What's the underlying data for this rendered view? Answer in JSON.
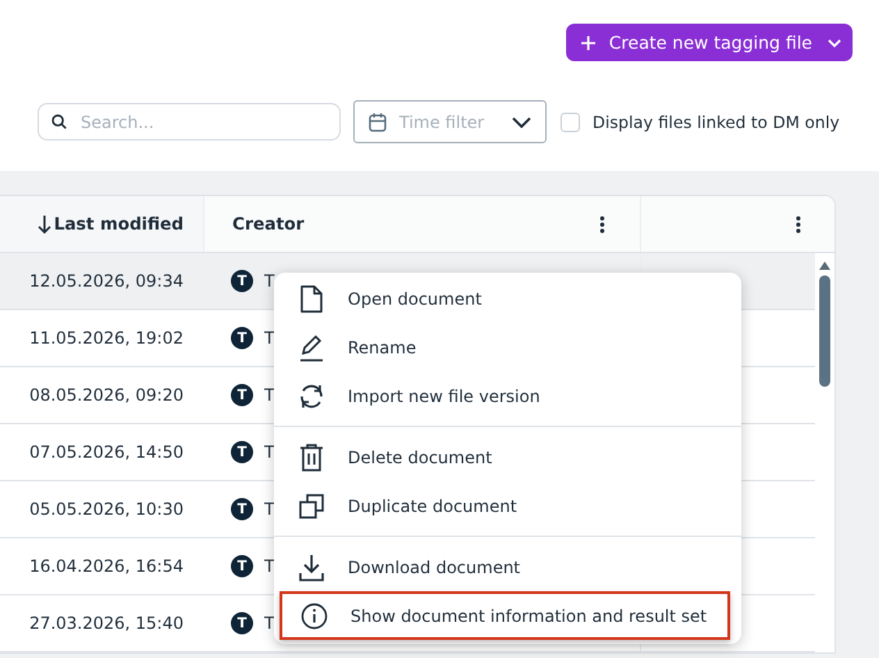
{
  "create_button": {
    "label": "Create new tagging file"
  },
  "filters": {
    "search": {
      "placeholder": "Search..."
    },
    "time_filter": {
      "placeholder": "Time filter"
    },
    "linked_checkbox": {
      "label": "Display files linked to DM only",
      "checked": false
    }
  },
  "table": {
    "columns": [
      {
        "label": "Last modified",
        "sorted_desc": true,
        "menu": false
      },
      {
        "label": "Creator",
        "sorted_desc": false,
        "menu": true
      },
      {
        "sorted_desc": false,
        "menu": true
      }
    ],
    "rows": [
      {
        "last_modified": "12.05.2026, 09:34",
        "avatar": "T",
        "creator": "T",
        "selected": true
      },
      {
        "last_modified": "11.05.2026, 19:02",
        "avatar": "T",
        "creator": "T",
        "selected": false
      },
      {
        "last_modified": "08.05.2026, 09:20",
        "avatar": "T",
        "creator": "T",
        "selected": false
      },
      {
        "last_modified": "07.05.2026, 14:50",
        "avatar": "T",
        "creator": "T",
        "selected": false
      },
      {
        "last_modified": "05.05.2026, 10:30",
        "avatar": "T",
        "creator": "T",
        "selected": false
      },
      {
        "last_modified": "16.04.2026, 16:54",
        "avatar": "T",
        "creator": "T",
        "selected": false
      },
      {
        "last_modified": "27.03.2026, 15:40",
        "avatar": "T",
        "creator": "T",
        "selected": false
      }
    ]
  },
  "context_menu": {
    "groups": [
      [
        {
          "kind": "file",
          "label": "Open document",
          "selected": false
        },
        {
          "kind": "pencil",
          "label": "Rename",
          "selected": false
        },
        {
          "kind": "cycle",
          "label": "Import new file version",
          "selected": false
        }
      ],
      [
        {
          "kind": "trash",
          "label": "Delete document",
          "selected": false
        },
        {
          "kind": "copy",
          "label": "Duplicate document",
          "selected": false
        }
      ],
      [
        {
          "kind": "download",
          "label": "Download document",
          "selected": false
        },
        {
          "kind": "info",
          "label": "Show document information and result set",
          "selected": true
        }
      ]
    ]
  }
}
